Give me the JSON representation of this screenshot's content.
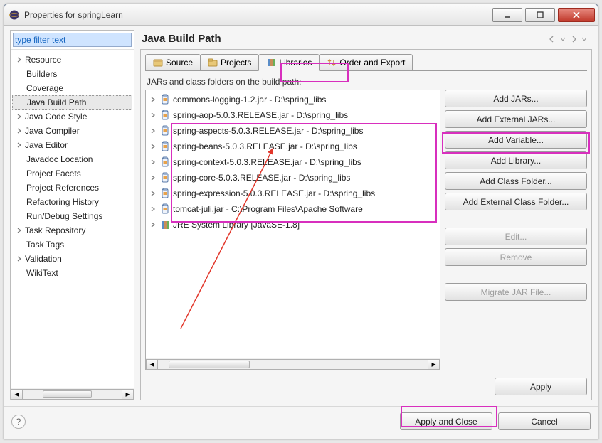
{
  "window": {
    "title": "Properties for springLearn"
  },
  "sidebar": {
    "filter_value": "type filter text",
    "items": [
      {
        "label": "Resource",
        "expandable": true
      },
      {
        "label": "Builders",
        "expandable": false
      },
      {
        "label": "Coverage",
        "expandable": false
      },
      {
        "label": "Java Build Path",
        "expandable": false,
        "selected": true
      },
      {
        "label": "Java Code Style",
        "expandable": true
      },
      {
        "label": "Java Compiler",
        "expandable": true
      },
      {
        "label": "Java Editor",
        "expandable": true
      },
      {
        "label": "Javadoc Location",
        "expandable": false
      },
      {
        "label": "Project Facets",
        "expandable": false
      },
      {
        "label": "Project References",
        "expandable": false
      },
      {
        "label": "Refactoring History",
        "expandable": false
      },
      {
        "label": "Run/Debug Settings",
        "expandable": false
      },
      {
        "label": "Task Repository",
        "expandable": true
      },
      {
        "label": "Task Tags",
        "expandable": false
      },
      {
        "label": "Validation",
        "expandable": true
      },
      {
        "label": "WikiText",
        "expandable": false
      }
    ]
  },
  "page": {
    "title": "Java Build Path"
  },
  "tabs": [
    {
      "label": "Source",
      "icon": "package-icon",
      "active": false
    },
    {
      "label": "Projects",
      "icon": "projects-icon",
      "active": false
    },
    {
      "label": "Libraries",
      "icon": "libraries-icon",
      "active": true
    },
    {
      "label": "Order and Export",
      "icon": "order-icon",
      "active": false
    }
  ],
  "list_label": "JARs and class folders on the build path:",
  "jars": [
    {
      "text": "commons-logging-1.2.jar - D:\\spring_libs",
      "type": "jar"
    },
    {
      "text": "spring-aop-5.0.3.RELEASE.jar - D:\\spring_libs",
      "type": "jar"
    },
    {
      "text": "spring-aspects-5.0.3.RELEASE.jar - D:\\spring_libs",
      "type": "jar"
    },
    {
      "text": "spring-beans-5.0.3.RELEASE.jar - D:\\spring_libs",
      "type": "jar"
    },
    {
      "text": "spring-context-5.0.3.RELEASE.jar - D:\\spring_libs",
      "type": "jar"
    },
    {
      "text": "spring-core-5.0.3.RELEASE.jar - D:\\spring_libs",
      "type": "jar"
    },
    {
      "text": "spring-expression-5.0.3.RELEASE.jar - D:\\spring_libs",
      "type": "jar"
    },
    {
      "text": "tomcat-juli.jar - C:\\Program Files\\Apache Software",
      "type": "jar"
    },
    {
      "text": "JRE System Library [JavaSE-1.8]",
      "type": "lib"
    }
  ],
  "buttons": {
    "add_jars": "Add JARs...",
    "add_ext_jars": "Add External JARs...",
    "add_variable": "Add Variable...",
    "add_library": "Add Library...",
    "add_class_folder": "Add Class Folder...",
    "add_ext_class_folder": "Add External Class Folder...",
    "edit": "Edit...",
    "remove": "Remove",
    "migrate": "Migrate JAR File...",
    "apply": "Apply",
    "apply_close": "Apply and Close",
    "cancel": "Cancel"
  }
}
